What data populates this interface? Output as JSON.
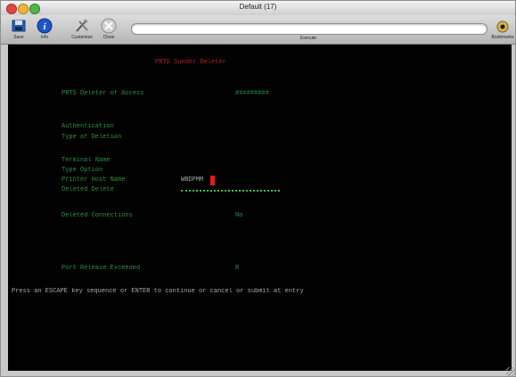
{
  "window": {
    "title": "Default (17)"
  },
  "toolbar": {
    "buttons": [
      {
        "label": "Save",
        "icon": "save-icon"
      },
      {
        "label": "Info",
        "icon": "info-icon"
      },
      {
        "label": "Customize",
        "icon": "customize-icon"
      },
      {
        "label": "Close",
        "icon": "close-icon"
      }
    ],
    "execute_label": "Execute",
    "execute_value": "",
    "right_button": {
      "label": "Bookmarks",
      "icon": "bookmarks-icon"
    }
  },
  "terminal": {
    "heading": "PRTS Sunder Deleter",
    "field1_label": "PRTS Deleter of Access",
    "field1_value": "#########",
    "group1_line1": "Authentication",
    "group1_line2": "Type of Deletion",
    "group2_line1": "Terminal Name",
    "group2_line2": "Type Option",
    "group2_line3": "Printer Host Name",
    "group2_line4": "Deleted Delete",
    "input_value": "WBDPMM",
    "field2_label": "Deleted Connections",
    "field2_value": "No",
    "field3_label": "Port Release Exceeded",
    "field3_value": "R",
    "status_line": "Press an ESCAPE key sequence or ENTER to continue or cancel or submit at entry"
  },
  "colors": {
    "terminal_bg": "#000000",
    "terminal_text": "#2fb04a",
    "heading": "#d8282b",
    "cursor": "#e01c1c"
  }
}
